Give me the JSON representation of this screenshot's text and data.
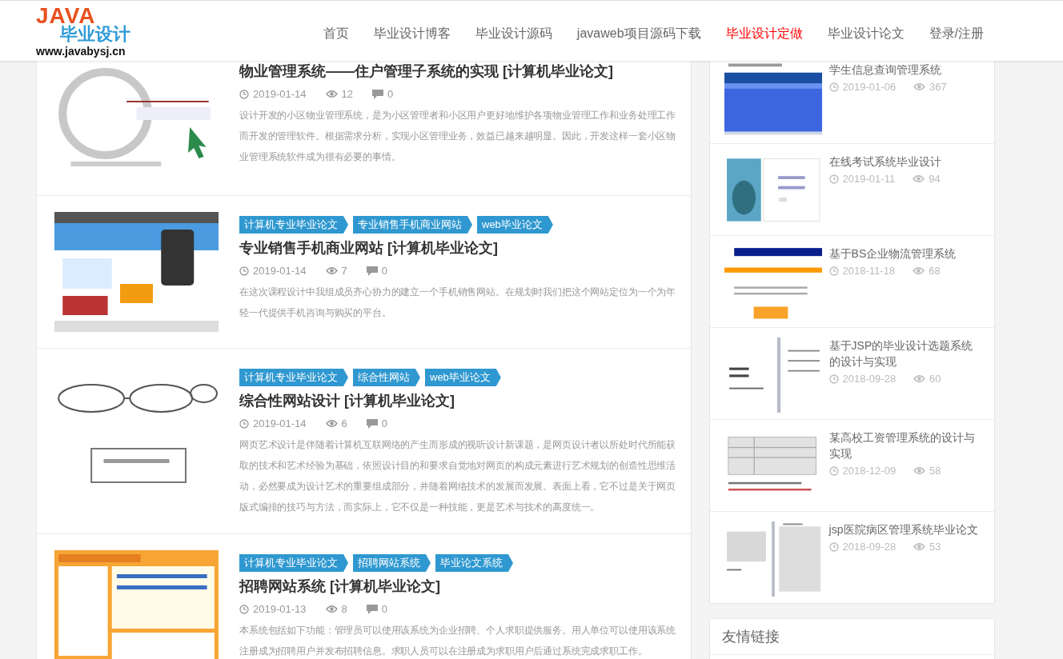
{
  "logo": {
    "title": "JAVA",
    "subtitle": "毕业设计",
    "url": "www.javabysj.cn"
  },
  "nav": [
    {
      "label": "首页",
      "selected": false
    },
    {
      "label": "毕业设计博客",
      "selected": false
    },
    {
      "label": "毕业设计源码",
      "selected": false
    },
    {
      "label": "javaweb项目源码下载",
      "selected": false
    },
    {
      "label": "毕业设计定做",
      "selected": true
    },
    {
      "label": "毕业设计论文",
      "selected": false
    },
    {
      "label": "登录/注册",
      "selected": false
    }
  ],
  "articles": [
    {
      "title": "物业管理系统——住户管理子系统的实现 [计算机毕业论文]",
      "date": "2019-01-14",
      "views": "12",
      "comments": "0",
      "excerpt": "设计开发的小区物业管理系统，是为小区管理者和小区用户更好地维护各项物业管理工作和业务处理工作而开发的管理软件。根据需求分析，实现小区管理业务，效益已越来越明显。因此，开发这样一套小区物业管理系统软件成为很有必要的事情。"
    },
    {
      "tags": [
        "计算机专业毕业论文",
        "专业销售手机商业网站",
        "web毕业论文"
      ],
      "title": "专业销售手机商业网站 [计算机毕业论文]",
      "date": "2019-01-14",
      "views": "7",
      "comments": "0",
      "excerpt": "在这次课程设计中我组成员齐心协力的建立一个手机销售网站。在规划时我们把这个网站定位为一个为年轻一代提供手机咨询与购买的平台。"
    },
    {
      "tags": [
        "计算机专业毕业论文",
        "综合性网站",
        "web毕业论文"
      ],
      "title": "综合性网站设计 [计算机毕业论文]",
      "date": "2019-01-14",
      "views": "6",
      "comments": "0",
      "excerpt": "网页艺术设计是伴随着计算机互联网络的产生而形成的视听设计新课题，是网页设计者以所处时代所能获取的技术和艺术经验为基础，依照设计目的和要求自觉地对网页的构成元素进行艺术规划的创造性思维活动，必然要成为设计艺术的重要组成部分，并随着网络技术的发展而发展。表面上看，它不过是关于网页版式编排的技巧与方法，而实际上，它不仅是一种技能，更是艺术与技术的高度统一。"
    },
    {
      "tags": [
        "计算机专业毕业论文",
        "招聘网站系统",
        "毕业论文系统"
      ],
      "title": "招聘网站系统 [计算机毕业论文]",
      "date": "2019-01-13",
      "views": "8",
      "comments": "0",
      "excerpt": "本系统包括如下功能：管理员可以使用该系统为企业招聘、个人求职提供服务。用人单位可以使用该系统注册成为招聘用户并发布招聘信息。求职人员可以在注册成为求职用户后通过系统完成求职工作。"
    }
  ],
  "sidebar": {
    "items": [
      {
        "title": "学生信息查询管理系统",
        "date": "2019-01-06",
        "views": "367"
      },
      {
        "title": "在线考试系统毕业设计",
        "date": "2019-01-11",
        "views": "94"
      },
      {
        "title": "基于BS企业物流管理系统",
        "date": "2018-11-18",
        "views": "68"
      },
      {
        "title": "基于JSP的毕业设计选题系统的设计与实现",
        "date": "2018-09-28",
        "views": "60"
      },
      {
        "title": "某高校工资管理系统的设计与实现",
        "date": "2018-12-09",
        "views": "58"
      },
      {
        "title": "jsp医院病区管理系统毕业论文",
        "date": "2018-09-28",
        "views": "53"
      }
    ]
  },
  "links_widget": {
    "title": "友情链接"
  }
}
